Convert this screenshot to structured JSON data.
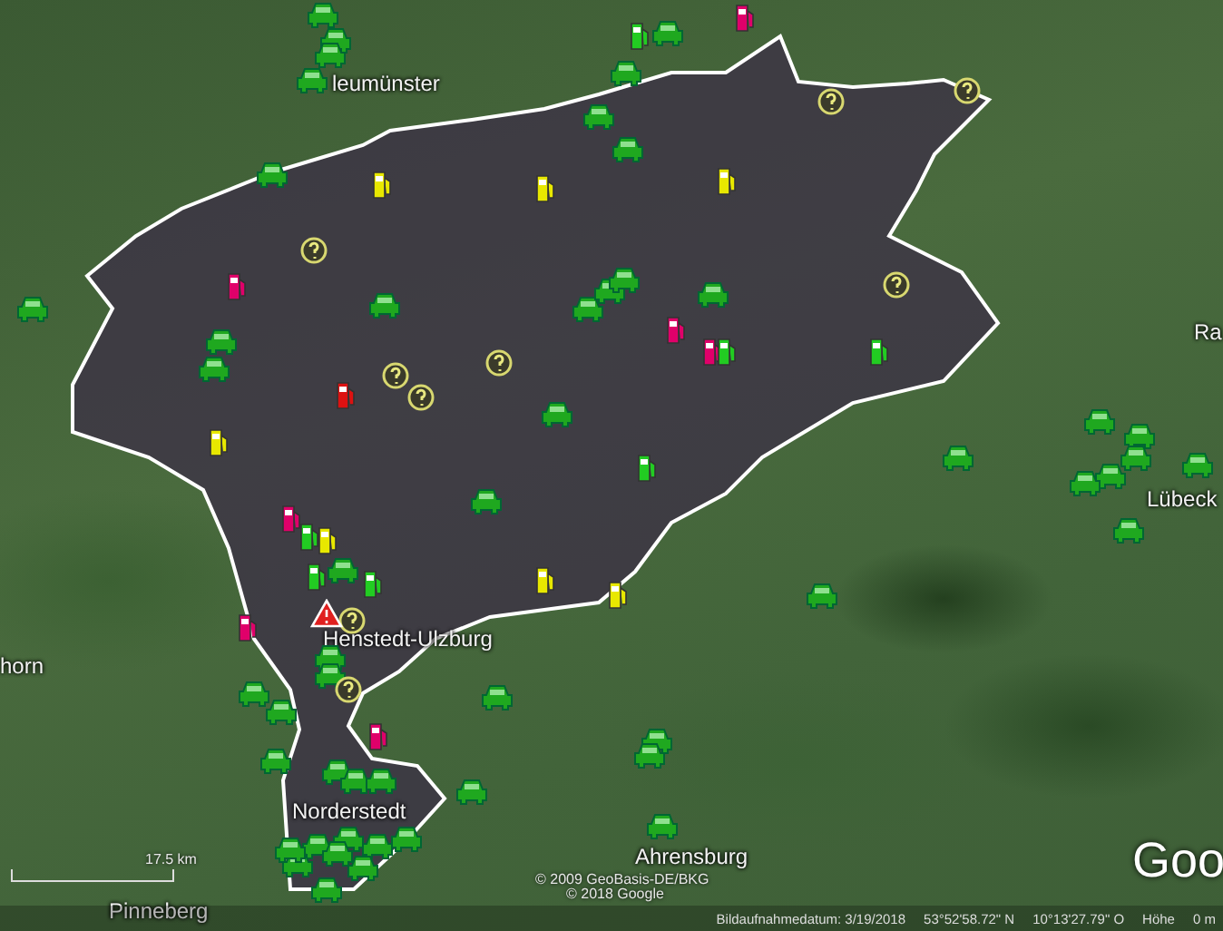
{
  "map": {
    "place_labels": [
      {
        "kind": "city",
        "text": "leumünster"
      },
      {
        "kind": "city",
        "text": "Henstedt-Ulzburg"
      },
      {
        "kind": "city",
        "text": "Norderstedt"
      },
      {
        "kind": "city",
        "text": "Ahrensburg"
      },
      {
        "kind": "city",
        "text": "Pinneberg"
      },
      {
        "kind": "city",
        "text": "Lübeck"
      },
      {
        "kind": "city",
        "text": "Ra"
      },
      {
        "kind": "city",
        "text": "horn"
      }
    ],
    "scale": {
      "label": "17.5 km"
    },
    "copyright": [
      "© 2009 GeoBasis-DE/BKG",
      "© 2018 Google"
    ],
    "logo": "Goo"
  },
  "status_bar": {
    "imagery_date": "Bildaufnahmedatum: 3/19/2018",
    "latitude": "53°52'58.72\" N",
    "longitude": "10°13'27.79\" O",
    "elevation_label": "Höhe",
    "elevation": "0 m"
  }
}
